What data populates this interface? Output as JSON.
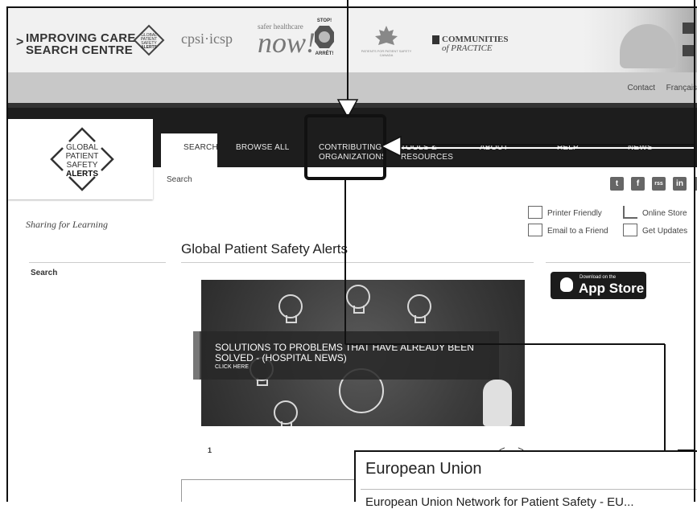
{
  "banner": {
    "ic_line1": "IMPROVING CARE",
    "ic_line2": "SEARCH CENTRE",
    "gpsa_small": [
      "GLOBAL",
      "PATIENT",
      "SAFETY",
      "ALERTS"
    ],
    "cpsi": "cpsi·icsp",
    "shn_top": "safer healthcare",
    "shn_main": "now!",
    "stop_top": "STOP!",
    "stop_bottom": "ARRÊT!",
    "ppc_text": "PATIENTS FOR PATIENT SAFETY CANADA",
    "cop_line1": "COMMUNITIES",
    "cop_line2": "of PRACTICE"
  },
  "util": {
    "contact": "Contact",
    "french": "Français"
  },
  "nav": {
    "items": [
      {
        "label": "SEARCH"
      },
      {
        "label": "BROWSE ALL"
      },
      {
        "label": "CONTRIBUTING ORGANIZATIONS"
      },
      {
        "label": "TOOLS & RESOURCES"
      },
      {
        "label": "ABOUT"
      },
      {
        "label": "HELP"
      },
      {
        "label": "NEWS"
      }
    ]
  },
  "logo": {
    "line1": "GLOBAL",
    "line2": "PATIENT",
    "line3": "SAFETY",
    "line4": "ALERTS"
  },
  "breadcrumb": "Search",
  "social": [
    "t",
    "f",
    "rss",
    "in",
    "yt"
  ],
  "tools": {
    "printer": "Printer Friendly",
    "store": "Online Store",
    "email": "Email to a Friend",
    "updates": "Get Updates"
  },
  "sidebar": {
    "tagline": "Sharing for Learning",
    "search": "Search"
  },
  "main": {
    "title": "Global Patient Safety Alerts"
  },
  "appstore": {
    "line1": "Download on the",
    "line2": "App Store"
  },
  "slider": {
    "caption": "SOLUTIONS TO PROBLEMS THAT HAVE ALREADY BEEN SOLVED - (HOSPITAL NEWS)",
    "click": "CLICK HERE",
    "page": "1",
    "arrows": "< >"
  },
  "callout": {
    "header": "European Union",
    "subtext": "European Union Network for Patient Safety - EU..."
  }
}
